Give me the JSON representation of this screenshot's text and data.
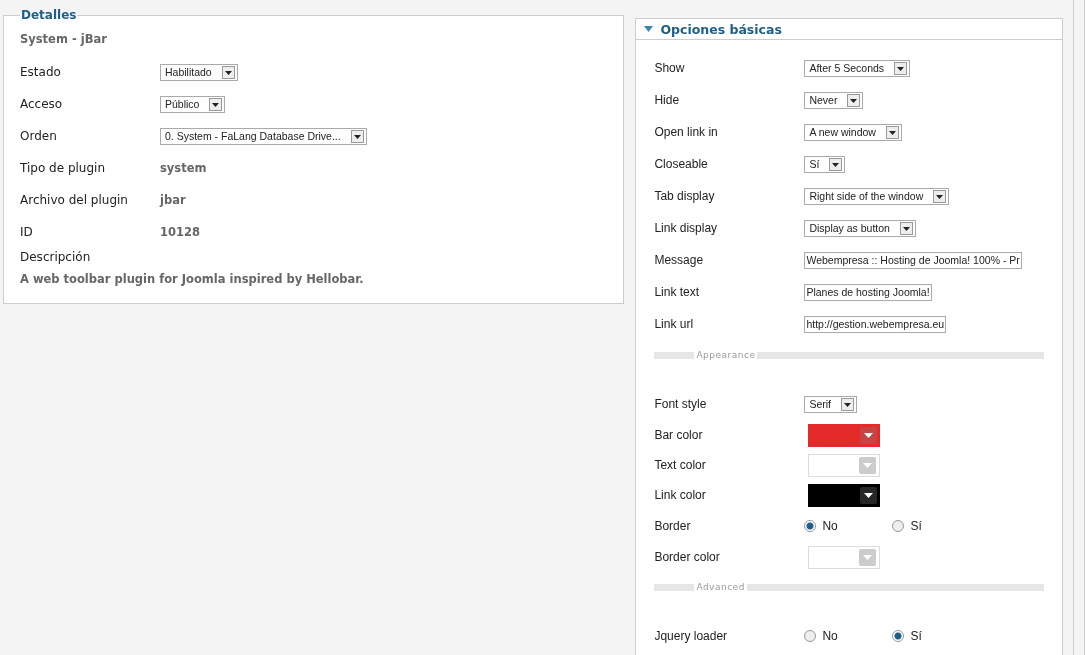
{
  "details": {
    "legend": "Detalles",
    "plugin_name": "System - jBar",
    "fields": [
      {
        "kind": "select",
        "label": "Estado",
        "value": "Habilitado"
      },
      {
        "kind": "select",
        "label": "Acceso",
        "value": "Público"
      },
      {
        "kind": "select",
        "label": "Orden",
        "value": "0. System - FaLang Database Drive..."
      },
      {
        "kind": "static",
        "label": "Tipo de plugin",
        "value": "system"
      },
      {
        "kind": "static",
        "label": "Archivo del plugin",
        "value": "jbar"
      },
      {
        "kind": "static",
        "label": "ID",
        "value": "10128"
      }
    ],
    "description_label": "Descripción",
    "description": "A web toolbar plugin for Joomla inspired by Hellobar."
  },
  "options": {
    "title": "Opciones básicas",
    "expanded": true,
    "rows": [
      {
        "kind": "select",
        "label": "Show",
        "value": "After 5 Seconds"
      },
      {
        "kind": "select",
        "label": "Hide",
        "value": "Never"
      },
      {
        "kind": "select",
        "label": "Open link in",
        "value": "A new window"
      },
      {
        "kind": "select",
        "label": "Closeable",
        "value": "Sí"
      },
      {
        "kind": "select",
        "label": "Tab display",
        "value": "Right side of the window"
      },
      {
        "kind": "select",
        "label": "Link display",
        "value": "Display as button"
      },
      {
        "kind": "text",
        "label": "Message",
        "value": "Webempresa :: Hosting de Joomla! 100% - Pr"
      },
      {
        "kind": "text",
        "label": "Link text",
        "value": "Planes de hosting Joomla!"
      },
      {
        "kind": "text",
        "label": "Link url",
        "value": "http://gestion.webempresa.eu"
      },
      {
        "kind": "separator",
        "label": "Appearance"
      },
      {
        "kind": "select",
        "label": "Font style",
        "value": "Serif"
      },
      {
        "kind": "color",
        "label": "Bar color",
        "color": "#e52a2a",
        "disabled": false
      },
      {
        "kind": "color",
        "label": "Text color",
        "color": "#ffffff",
        "disabled": true
      },
      {
        "kind": "color",
        "label": "Link color",
        "color": "#000000",
        "disabled": false
      },
      {
        "kind": "radio",
        "label": "Border",
        "options": [
          {
            "label": "No",
            "selected": true
          },
          {
            "label": "Sí",
            "selected": false
          }
        ]
      },
      {
        "kind": "color",
        "label": "Border color",
        "color": "#ffffff",
        "disabled": true
      },
      {
        "kind": "separator",
        "label": "Advanced"
      },
      {
        "kind": "radio",
        "label": "Jquery loader",
        "options": [
          {
            "label": "No",
            "selected": false
          },
          {
            "label": "Sí",
            "selected": true
          }
        ]
      }
    ]
  }
}
